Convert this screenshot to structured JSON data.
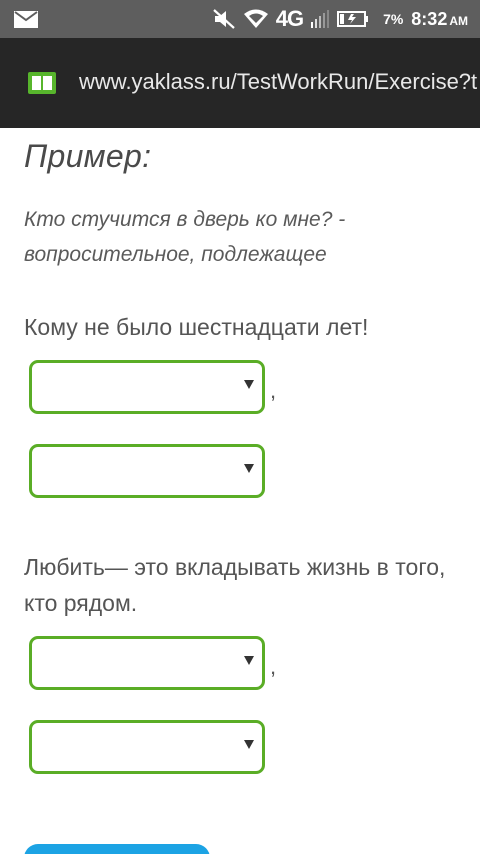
{
  "status_bar": {
    "network": "4G",
    "battery_percent": "7%",
    "time": "8:32",
    "ampm": "AM"
  },
  "browser": {
    "url": "www.yaklass.ru/TestWorkRun/Exercise?t"
  },
  "exercise": {
    "example_heading": "Пример:",
    "example_text": "Кто стучится в дверь ко мне? - вопросительное, подлежащее",
    "sentence_1": "Кому не было шестнадцати лет!",
    "sentence_2": "Любить— это вкладывать жизнь в того, кто рядом.",
    "comma": ","
  },
  "colors": {
    "select_border": "#5aad26",
    "button": "#1ca3e4",
    "status_bar": "#5e5e5e",
    "url_bar": "#262626"
  }
}
